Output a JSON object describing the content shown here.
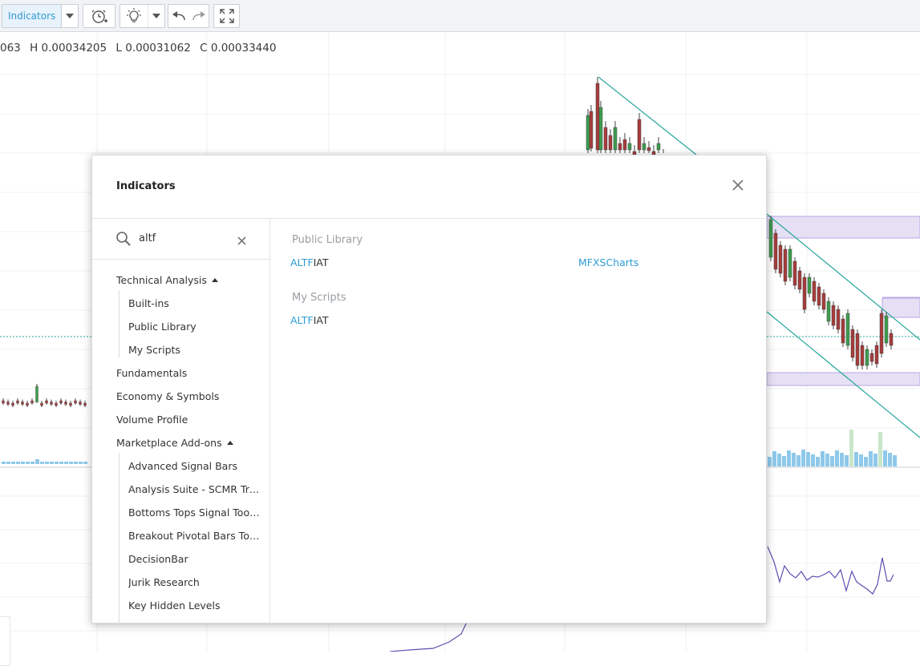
{
  "toolbar": {
    "indicators_label": "Indicators",
    "buttons": [
      "indicators-dropdown",
      "alert-clock-plus-icon",
      "lightbulb-icon",
      "undo-icon",
      "redo-icon",
      "fullscreen-icon"
    ]
  },
  "ohlc": {
    "open_fragment": "063",
    "high": "H 0.00034205",
    "low": "L 0.00031062",
    "close": "C 0.00033440"
  },
  "colors": {
    "accent": "#2f9bd4",
    "trendline": "#26a69a",
    "zone_fill": "#e6e0f5",
    "zone_border": "#b9a6e0",
    "candle_up": "#3c9d4e",
    "candle_down": "#a73b3b",
    "volume": "#8ec8ea",
    "oscillator": "#5a4fb0"
  },
  "dialog": {
    "title": "Indicators",
    "search": {
      "value": "altf",
      "placeholder": ""
    },
    "sidebar": {
      "technical_analysis": "Technical Analysis",
      "built_ins": "Built-ins",
      "public_library": "Public Library",
      "my_scripts": "My Scripts",
      "fundamentals": "Fundamentals",
      "economy_symbols": "Economy & Symbols",
      "volume_profile": "Volume Profile",
      "marketplace_addons": "Marketplace Add-ons",
      "marketplace_items": [
        "Advanced Signal Bars",
        "Analysis Suite - SCMR Tre...",
        "Bottoms Tops Signal Toolkit",
        "Breakout Pivotal Bars Tool...",
        "DecisionBar",
        "Jurik Research",
        "Key Hidden Levels"
      ]
    },
    "results": {
      "public_library_title": "Public Library",
      "public_library_items": [
        {
          "highlight": "ALTF",
          "rest": "IAT",
          "author": "MFXSCharts"
        }
      ],
      "my_scripts_title": "My Scripts",
      "my_scripts_items": [
        {
          "highlight": "ALTF",
          "rest": "IAT"
        }
      ]
    }
  }
}
